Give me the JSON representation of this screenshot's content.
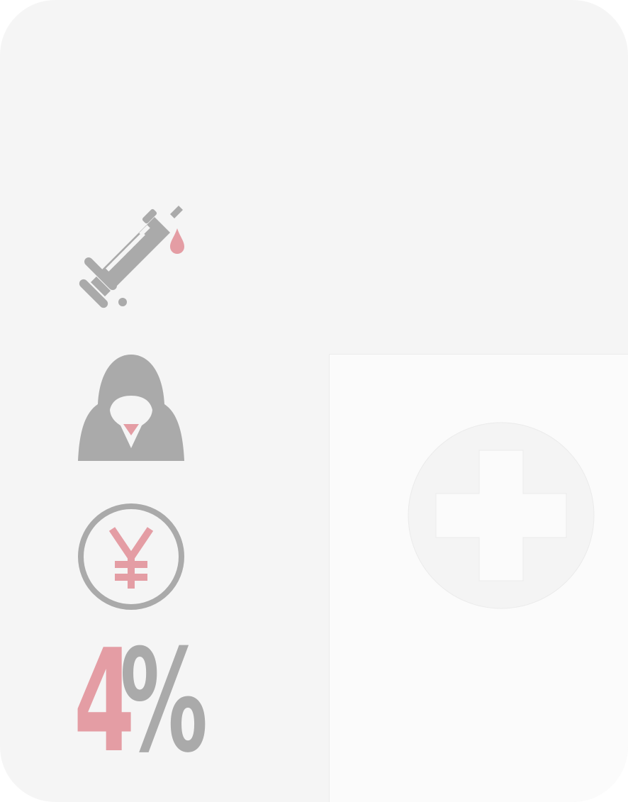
{
  "stats": {
    "percent_value": "4",
    "percent_sign": "%"
  },
  "icons": {
    "syringe": "syringe-icon",
    "hooded_figure": "hooded-figure-icon",
    "yen": "yen-coin-icon",
    "medical_cross": "medical-cross-icon"
  },
  "colors": {
    "background": "#f5f5f5",
    "panel": "#fbfbfb",
    "gray": "#aaaaaa",
    "accent": "#e49da4"
  }
}
